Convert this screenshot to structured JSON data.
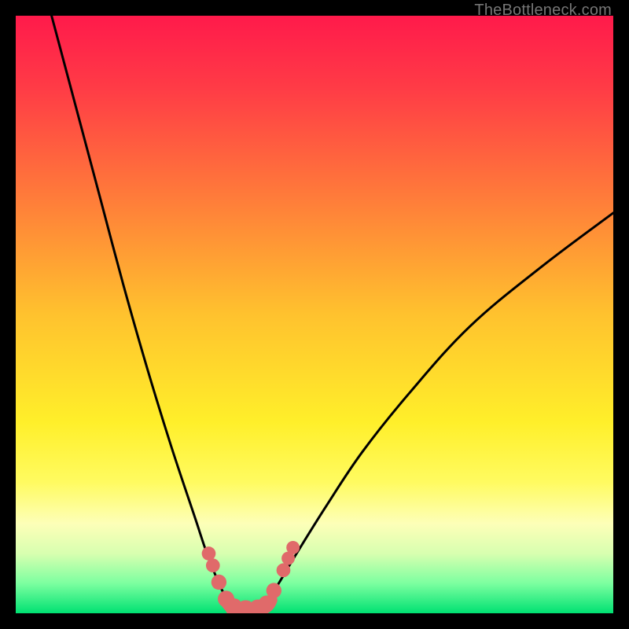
{
  "watermark": "TheBottleneck.com",
  "chart_data": {
    "type": "line",
    "title": "",
    "xlabel": "",
    "ylabel": "",
    "xlim": [
      0,
      100
    ],
    "ylim": [
      0,
      100
    ],
    "grid": false,
    "legend": false,
    "background_gradient": {
      "stops": [
        {
          "offset": 0.0,
          "color": "#ff1a4b"
        },
        {
          "offset": 0.12,
          "color": "#ff3b46"
        },
        {
          "offset": 0.3,
          "color": "#ff7a3a"
        },
        {
          "offset": 0.5,
          "color": "#ffc22e"
        },
        {
          "offset": 0.68,
          "color": "#ffef2a"
        },
        {
          "offset": 0.78,
          "color": "#fffb60"
        },
        {
          "offset": 0.85,
          "color": "#fdffb8"
        },
        {
          "offset": 0.9,
          "color": "#d8ffb0"
        },
        {
          "offset": 0.95,
          "color": "#7cffa0"
        },
        {
          "offset": 1.0,
          "color": "#00e172"
        }
      ]
    },
    "series": [
      {
        "name": "bottleneck-curve-left",
        "x": [
          6,
          10,
          14,
          18,
          22,
          26,
          30,
          32,
          34,
          35.5
        ],
        "y": [
          100,
          85,
          70,
          55,
          41,
          28,
          16,
          10,
          5,
          2
        ]
      },
      {
        "name": "bottleneck-curve-right",
        "x": [
          42,
          44,
          47,
          52,
          58,
          66,
          76,
          88,
          100
        ],
        "y": [
          2,
          5,
          10,
          18,
          27,
          37,
          48,
          58,
          67
        ]
      }
    ],
    "flat_segment": {
      "name": "valley-floor",
      "x": [
        35.5,
        42
      ],
      "y": [
        0.5,
        0.5
      ]
    },
    "markers": {
      "name": "valley-markers",
      "color": "#e06a6a",
      "points": [
        {
          "x": 32.3,
          "y": 10.0,
          "r": 1.4
        },
        {
          "x": 33.0,
          "y": 8.0,
          "r": 1.4
        },
        {
          "x": 34.0,
          "y": 5.2,
          "r": 1.6
        },
        {
          "x": 35.2,
          "y": 2.4,
          "r": 1.8
        },
        {
          "x": 36.5,
          "y": 1.0,
          "r": 2.0
        },
        {
          "x": 38.5,
          "y": 0.7,
          "r": 2.0
        },
        {
          "x": 40.5,
          "y": 0.8,
          "r": 2.0
        },
        {
          "x": 42.0,
          "y": 1.6,
          "r": 1.8
        },
        {
          "x": 43.2,
          "y": 3.8,
          "r": 1.6
        },
        {
          "x": 44.8,
          "y": 7.2,
          "r": 1.4
        },
        {
          "x": 45.6,
          "y": 9.2,
          "r": 1.3
        },
        {
          "x": 46.4,
          "y": 11.0,
          "r": 1.3
        }
      ]
    }
  }
}
